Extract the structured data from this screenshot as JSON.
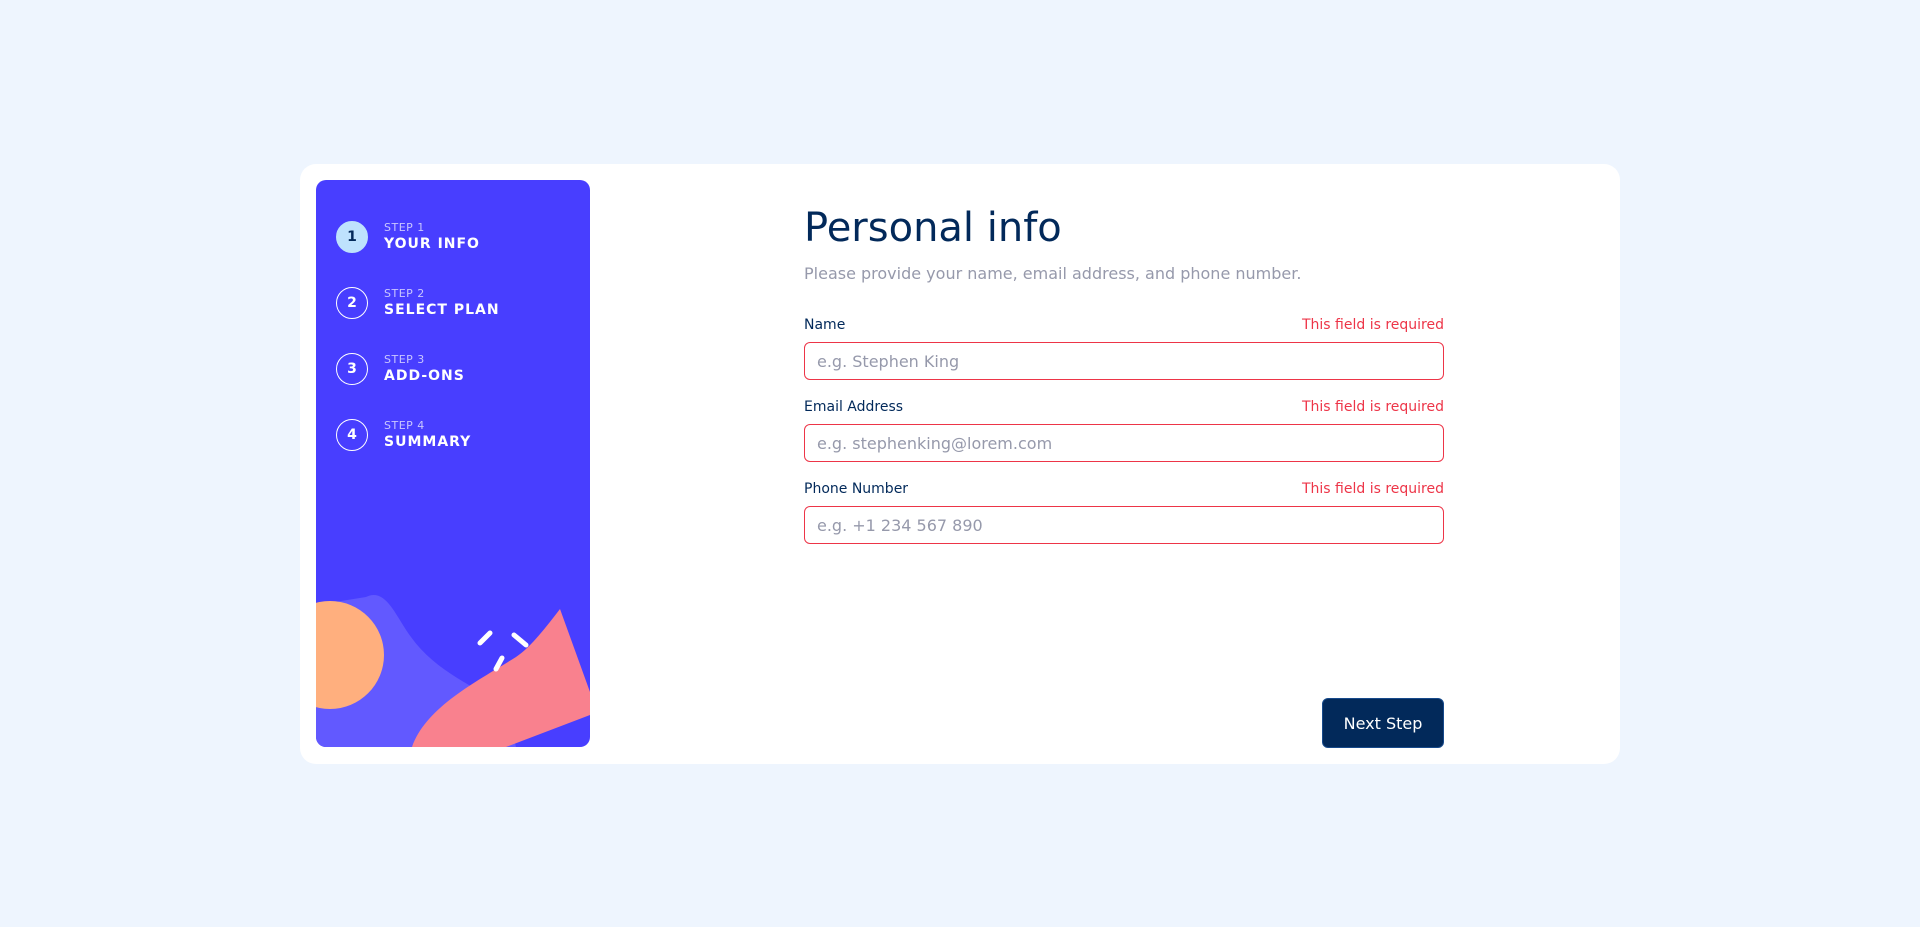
{
  "steps": [
    {
      "number": "1",
      "label_small": "STEP 1",
      "label": "YOUR INFO",
      "active": true
    },
    {
      "number": "2",
      "label_small": "STEP 2",
      "label": "SELECT PLAN",
      "active": false
    },
    {
      "number": "3",
      "label_small": "STEP 3",
      "label": "ADD-ONS",
      "active": false
    },
    {
      "number": "4",
      "label_small": "STEP 4",
      "label": "SUMMARY",
      "active": false
    }
  ],
  "main": {
    "title": "Personal info",
    "subtitle": "Please provide your name, email address, and phone number."
  },
  "form": {
    "name": {
      "label": "Name",
      "error": "This field is required",
      "placeholder": "e.g. Stephen King",
      "value": ""
    },
    "email": {
      "label": "Email Address",
      "error": "This field is required",
      "placeholder": "e.g. stephenking@lorem.com",
      "value": ""
    },
    "phone": {
      "label": "Phone Number",
      "error": "This field is required",
      "placeholder": "e.g. +1 234 567 890",
      "value": ""
    }
  },
  "actions": {
    "next_label": "Next Step"
  },
  "colors": {
    "sidebar_bg": "#483eff",
    "active_step": "#bee2fd",
    "error": "#ed3548",
    "primary": "#02295a",
    "page_bg": "#eef5fe"
  }
}
